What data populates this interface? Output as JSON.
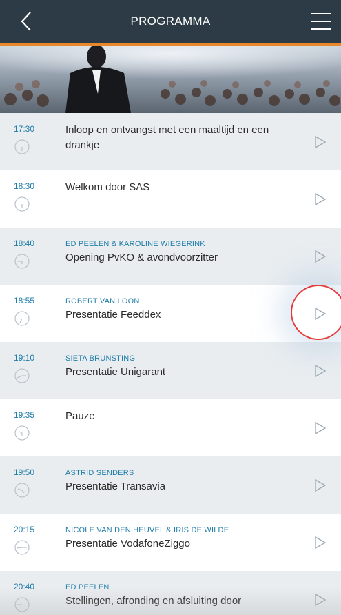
{
  "header": {
    "title": "PROGRAMMA"
  },
  "colors": {
    "header_bg": "#2c3b45",
    "accent": "#e9882a",
    "link": "#1f7ca8",
    "row_gray": "#e9edf0",
    "highlight": "#e23b3b"
  },
  "items": [
    {
      "time": "17:30",
      "speaker": "",
      "title": "Inloop en ontvangst met een maaltijd en een drankje"
    },
    {
      "time": "18:30",
      "speaker": "",
      "title": "Welkom door SAS"
    },
    {
      "time": "18:40",
      "speaker": "ED PEELEN & KAROLINE WIEGERINK",
      "title": "Opening PvKO & avondvoorzitter"
    },
    {
      "time": "18:55",
      "speaker": "ROBERT VAN LOON",
      "title": "Presentatie Feeddex"
    },
    {
      "time": "19:10",
      "speaker": "SIETA BRUNSTING",
      "title": "Presentatie Unigarant"
    },
    {
      "time": "19:35",
      "speaker": "",
      "title": "Pauze"
    },
    {
      "time": "19:50",
      "speaker": "ASTRID SENDERS",
      "title": "Presentatie Transavia"
    },
    {
      "time": "20:15",
      "speaker": "NICOLE VAN DEN HEUVEL & IRIS DE WILDE",
      "title": "Presentatie VodafoneZiggo"
    },
    {
      "time": "20:40",
      "speaker": "ED PEELEN",
      "title": "Stellingen, afronding en afsluiting door"
    }
  ]
}
